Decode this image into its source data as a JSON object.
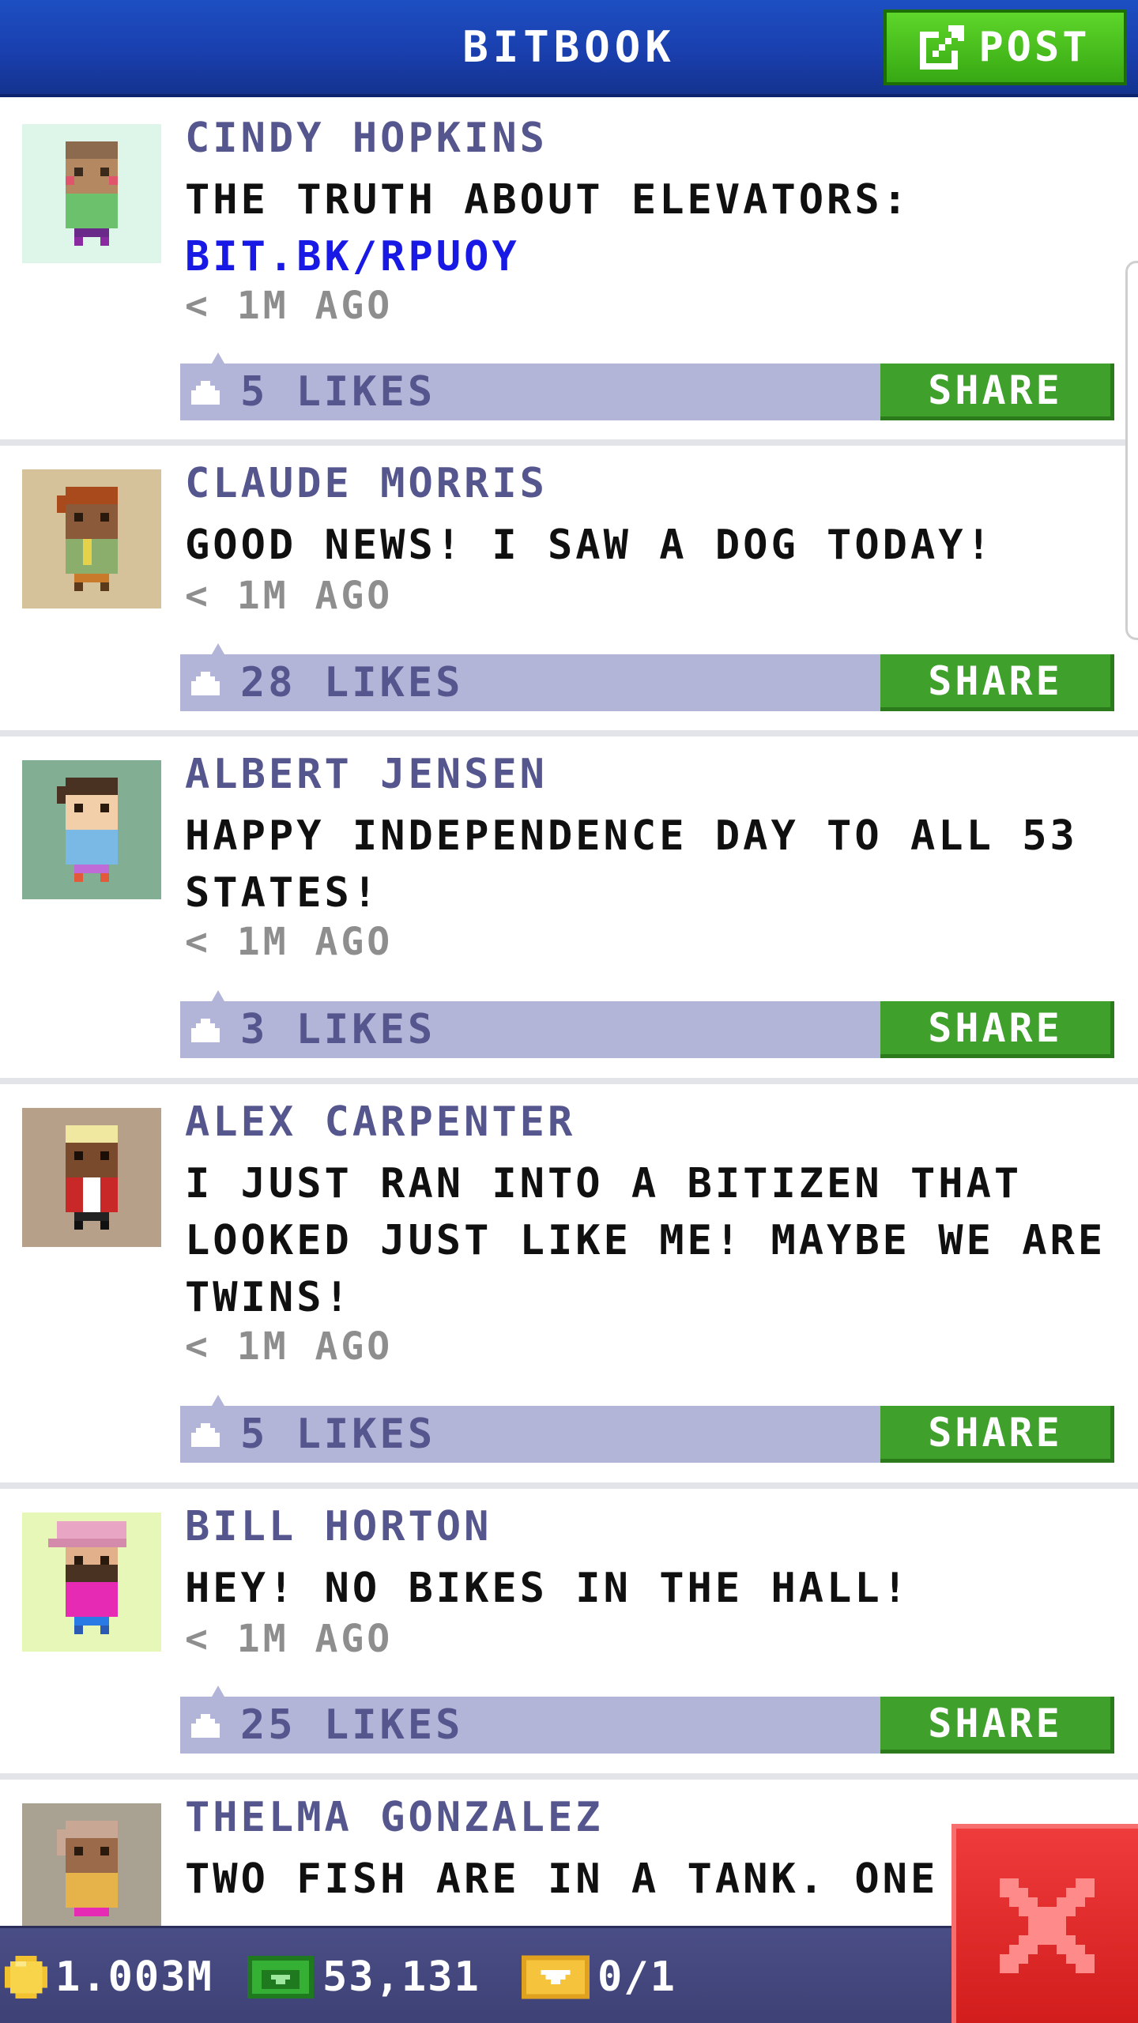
{
  "header": {
    "title": "BITBOOK",
    "post_label": "POST"
  },
  "feed": {
    "share_label": "SHARE",
    "posts": [
      {
        "name": "CINDY HOPKINS",
        "text": "THE TRUTH ABOUT ELEVATORS:",
        "link": "BIT.BK/RPUOY",
        "time": "< 1M AGO",
        "likes": "5 LIKES",
        "avatar_bg": "#def5ea"
      },
      {
        "name": "CLAUDE MORRIS",
        "text": "GOOD NEWS! I SAW A DOG TODAY!",
        "time": "< 1M AGO",
        "likes": "28 LIKES",
        "avatar_bg": "#d6c29a"
      },
      {
        "name": "ALBERT JENSEN",
        "text": "HAPPY INDEPENDENCE DAY TO ALL 53 STATES!",
        "time": "< 1M AGO",
        "likes": "3 LIKES",
        "avatar_bg": "#82ae93"
      },
      {
        "name": "ALEX CARPENTER",
        "text": "I JUST RAN INTO A BITIZEN THAT LOOKED JUST LIKE ME! MAYBE WE ARE TWINS!",
        "time": "< 1M AGO",
        "likes": "5 LIKES",
        "avatar_bg": "#b7a08a"
      },
      {
        "name": "BILL HORTON",
        "text": "HEY! NO BIKES IN THE HALL!",
        "time": "< 1M AGO",
        "likes": "25 LIKES",
        "avatar_bg": "#e6f7b8"
      },
      {
        "name": "THELMA GONZALEZ",
        "text": "TWO FISH ARE IN A TANK. ONE T",
        "avatar_bg": "#a9a293"
      }
    ]
  },
  "bottom_bar": {
    "coins": "1.003M",
    "bux": "53,131",
    "vip": "0/1"
  },
  "colors": {
    "header_blue": "#1a3fae",
    "accent_green": "#3fa02c",
    "likes_bar": "#b3b5d8",
    "name_purple": "#55568e",
    "link_blue": "#1919e6",
    "close_red": "#d21d1d"
  },
  "icons": [
    "post-edit-icon",
    "like-icon",
    "coin-icon",
    "cash-icon",
    "vip-ticket-icon",
    "close-icon"
  ]
}
